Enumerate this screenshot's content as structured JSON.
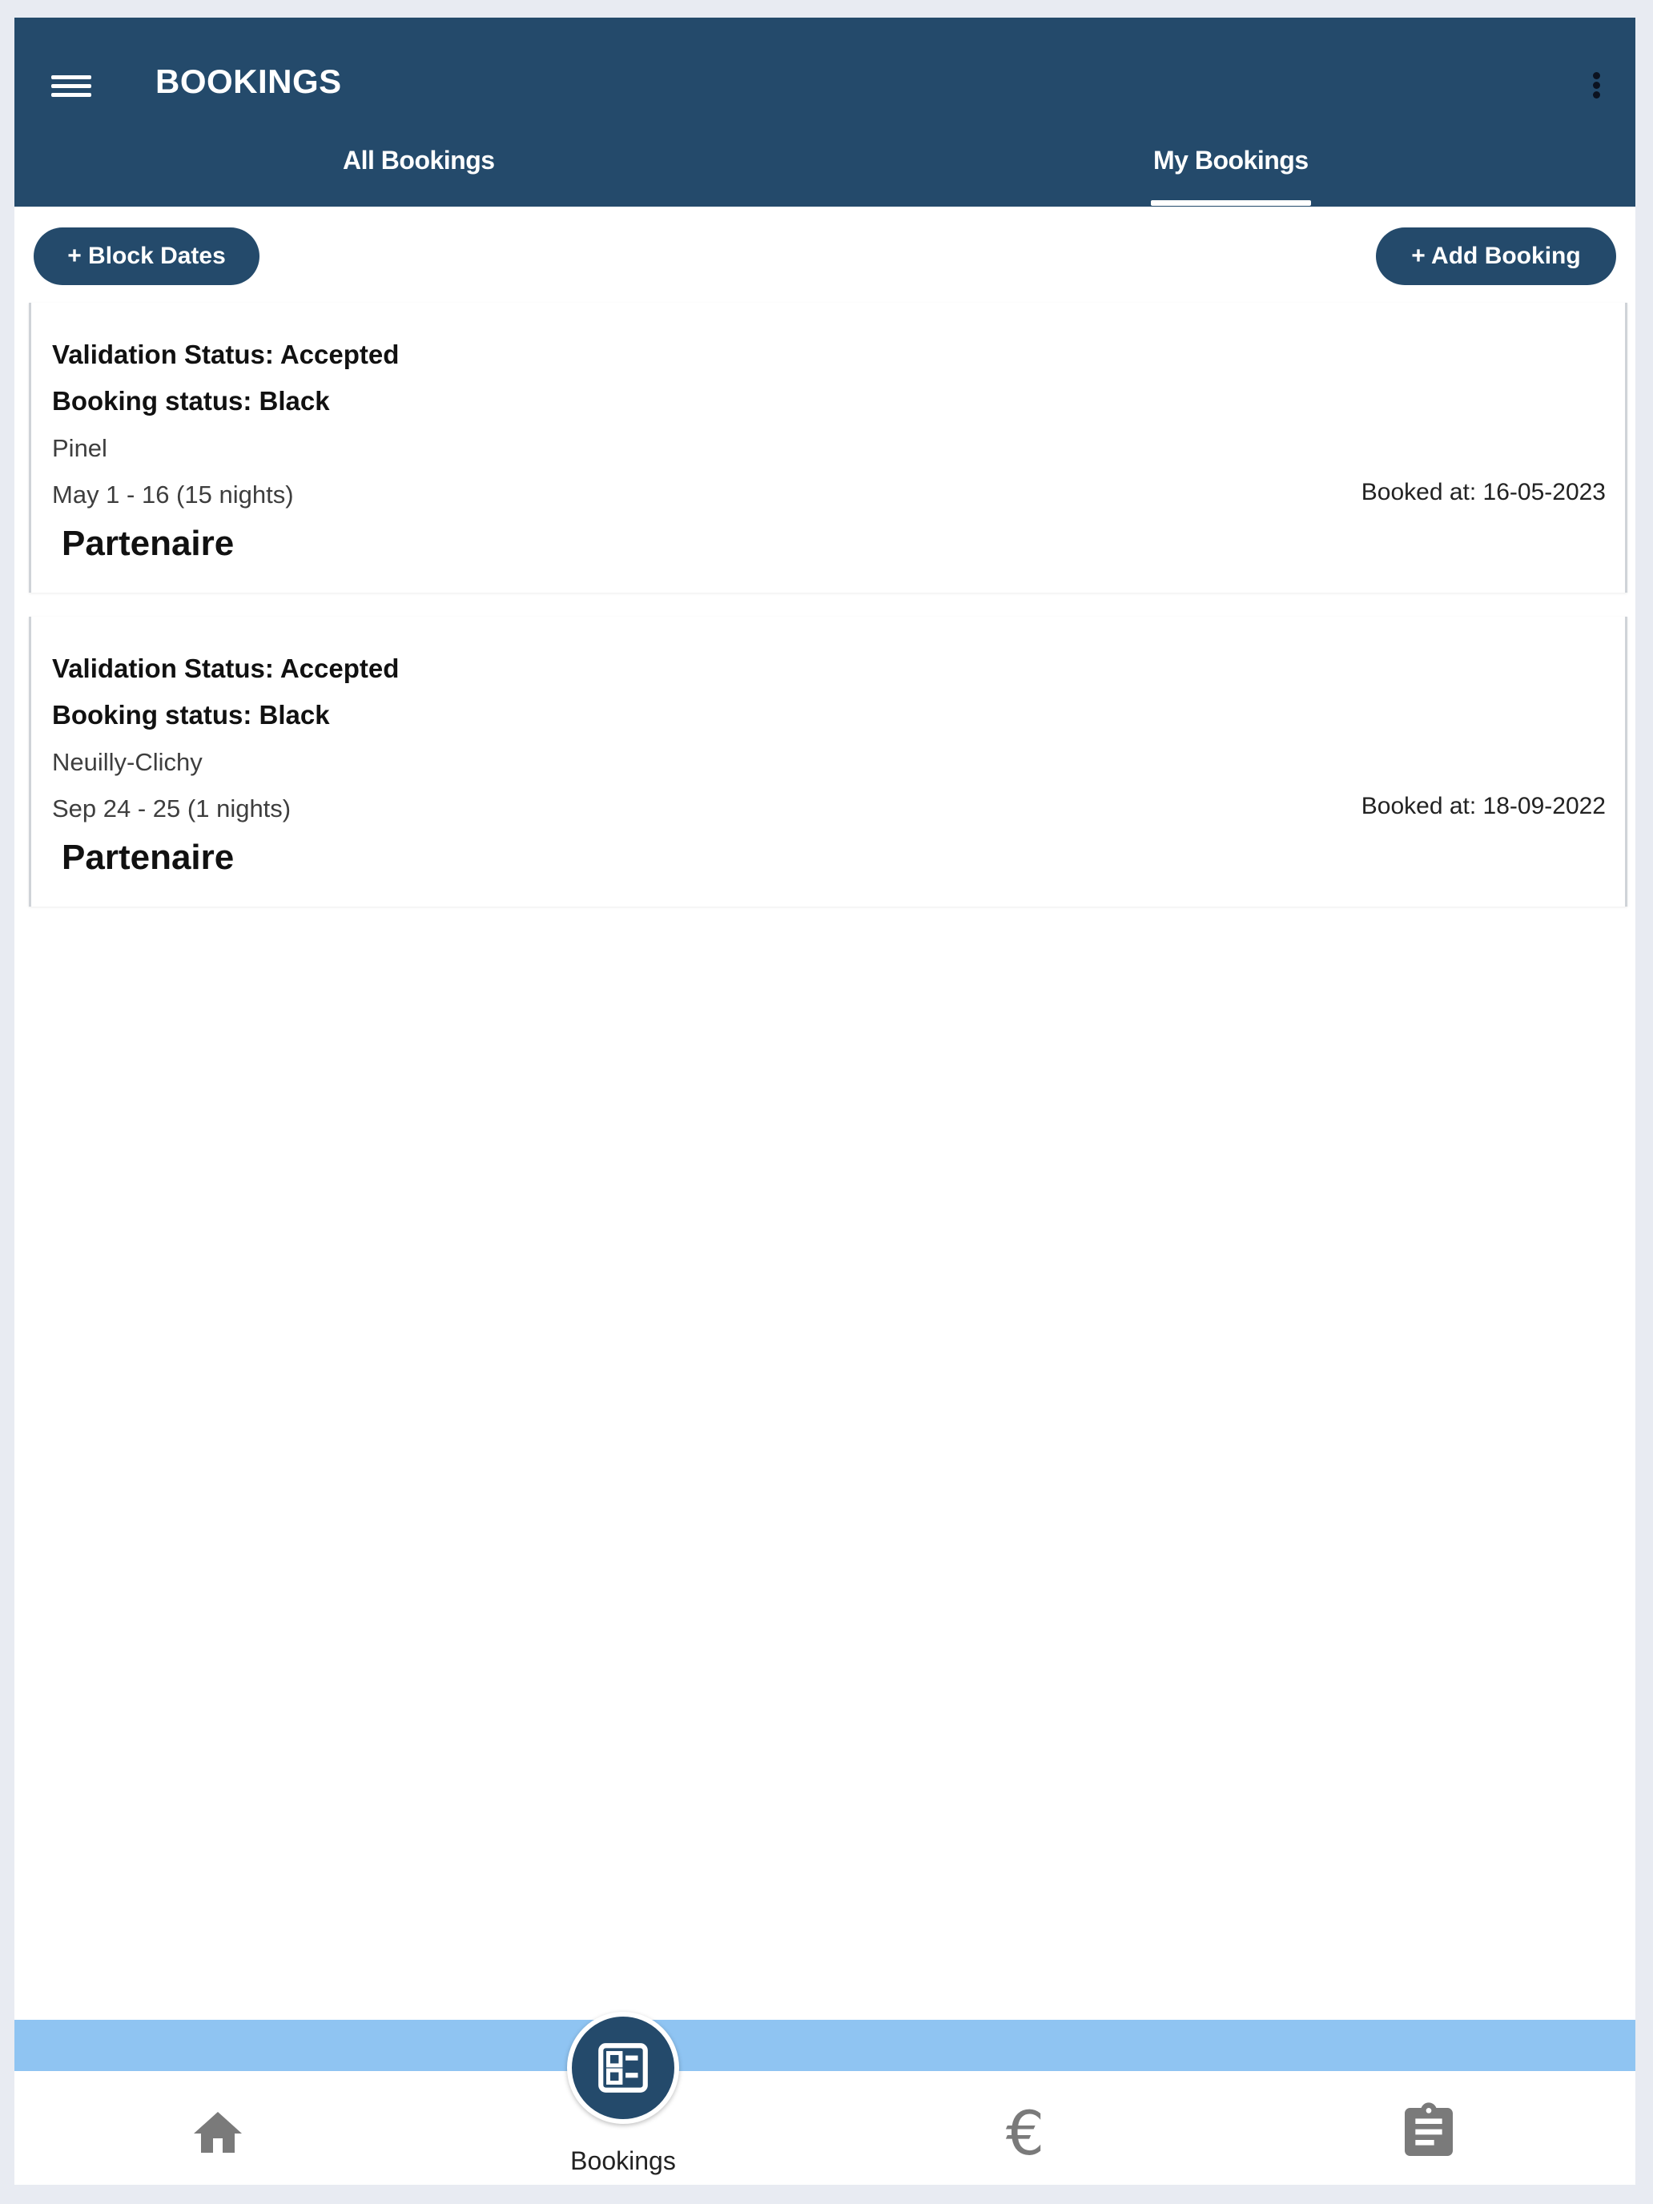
{
  "header": {
    "title": "BOOKINGS",
    "tabs": [
      {
        "label": "All Bookings",
        "active": false
      },
      {
        "label": "My Bookings",
        "active": true
      }
    ]
  },
  "actions": {
    "block_dates_label": "+ Block Dates",
    "add_booking_label": "+ Add Booking"
  },
  "bookings": [
    {
      "validation": "Validation Status: Accepted",
      "status": "Booking status: Black",
      "property": "Pinel",
      "dates": "May 1  -  16 (15 nights)",
      "booked_at": "Booked at: 16-05-2023",
      "type": "Partenaire"
    },
    {
      "validation": "Validation Status: Accepted",
      "status": "Booking status: Black",
      "property": "Neuilly-Clichy",
      "dates": "Sep 24  -  25 (1 nights)",
      "booked_at": "Booked at: 18-09-2022",
      "type": "Partenaire"
    }
  ],
  "bottom_nav": {
    "items": [
      {
        "icon": "home-icon",
        "label": ""
      },
      {
        "icon": "bookings-icon",
        "label": "Bookings",
        "active": true
      },
      {
        "icon": "euro-icon",
        "label": ""
      },
      {
        "icon": "clipboard-icon",
        "label": ""
      }
    ]
  },
  "colors": {
    "primary": "#244a6b",
    "accent_strip": "#8fc4f2",
    "page_bg": "#e8ebf2"
  }
}
